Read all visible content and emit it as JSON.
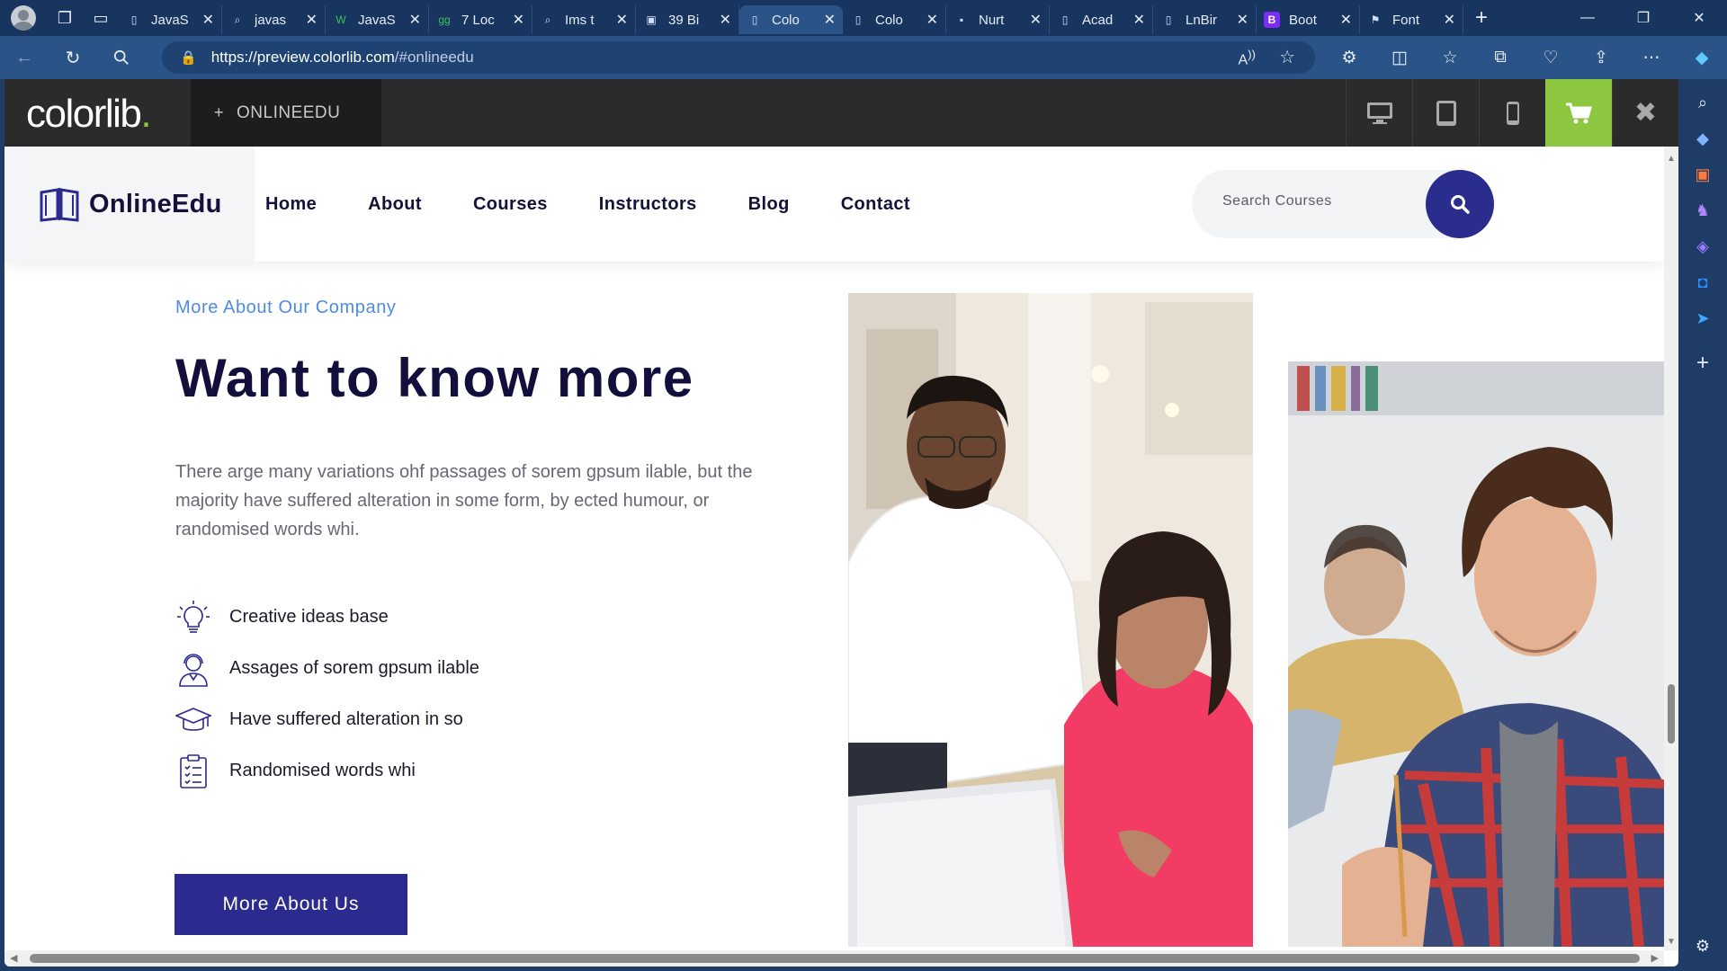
{
  "browser": {
    "tabs": [
      {
        "label": "JavaS",
        "icon": "page-icon"
      },
      {
        "label": "javas",
        "icon": "search-icon"
      },
      {
        "label": "JavaS",
        "icon": "w3-icon"
      },
      {
        "label": "7 Loc",
        "icon": "gfg-icon"
      },
      {
        "label": "Ims t",
        "icon": "search-icon"
      },
      {
        "label": "39 Bi",
        "icon": "tab-icon"
      },
      {
        "label": "Colo",
        "icon": "page-icon",
        "active": true
      },
      {
        "label": "Colo",
        "icon": "page-icon"
      },
      {
        "label": "Nurt",
        "icon": "site-icon"
      },
      {
        "label": "Acad",
        "icon": "page-icon"
      },
      {
        "label": "LnBir",
        "icon": "page-icon"
      },
      {
        "label": "Boot",
        "icon": "bootstrap-icon"
      },
      {
        "label": "Font",
        "icon": "flag-icon"
      }
    ],
    "url": {
      "host": "https://preview.colorlib.com",
      "path": "/#onlineedu"
    }
  },
  "colorlib": {
    "logo_text": "colorlib",
    "logo_dot": ".",
    "theme_label": "ONLINEEDU",
    "accent": "#8dc63f"
  },
  "site": {
    "brand": "OnlineEdu",
    "menu": [
      "Home",
      "About",
      "Courses",
      "Instructors",
      "Blog",
      "Contact"
    ],
    "search_placeholder": "Search Courses",
    "primary_color": "#2b2a8e"
  },
  "content": {
    "eyebrow": "More About Our Company",
    "headline": "Want to know more",
    "paragraph": "There arge many variations ohf passages of sorem gpsum ilable, but the majority have suffered alteration in some form, by ected humour, or randomised words whi.",
    "features": [
      {
        "icon": "lightbulb-icon",
        "text": "Creative ideas base"
      },
      {
        "icon": "support-agent-icon",
        "text": "Assages of sorem gpsum ilable"
      },
      {
        "icon": "graduation-cap-icon",
        "text": "Have suffered alteration in so"
      },
      {
        "icon": "checklist-icon",
        "text": "Randomised words whi"
      }
    ],
    "cta": "More About Us"
  }
}
